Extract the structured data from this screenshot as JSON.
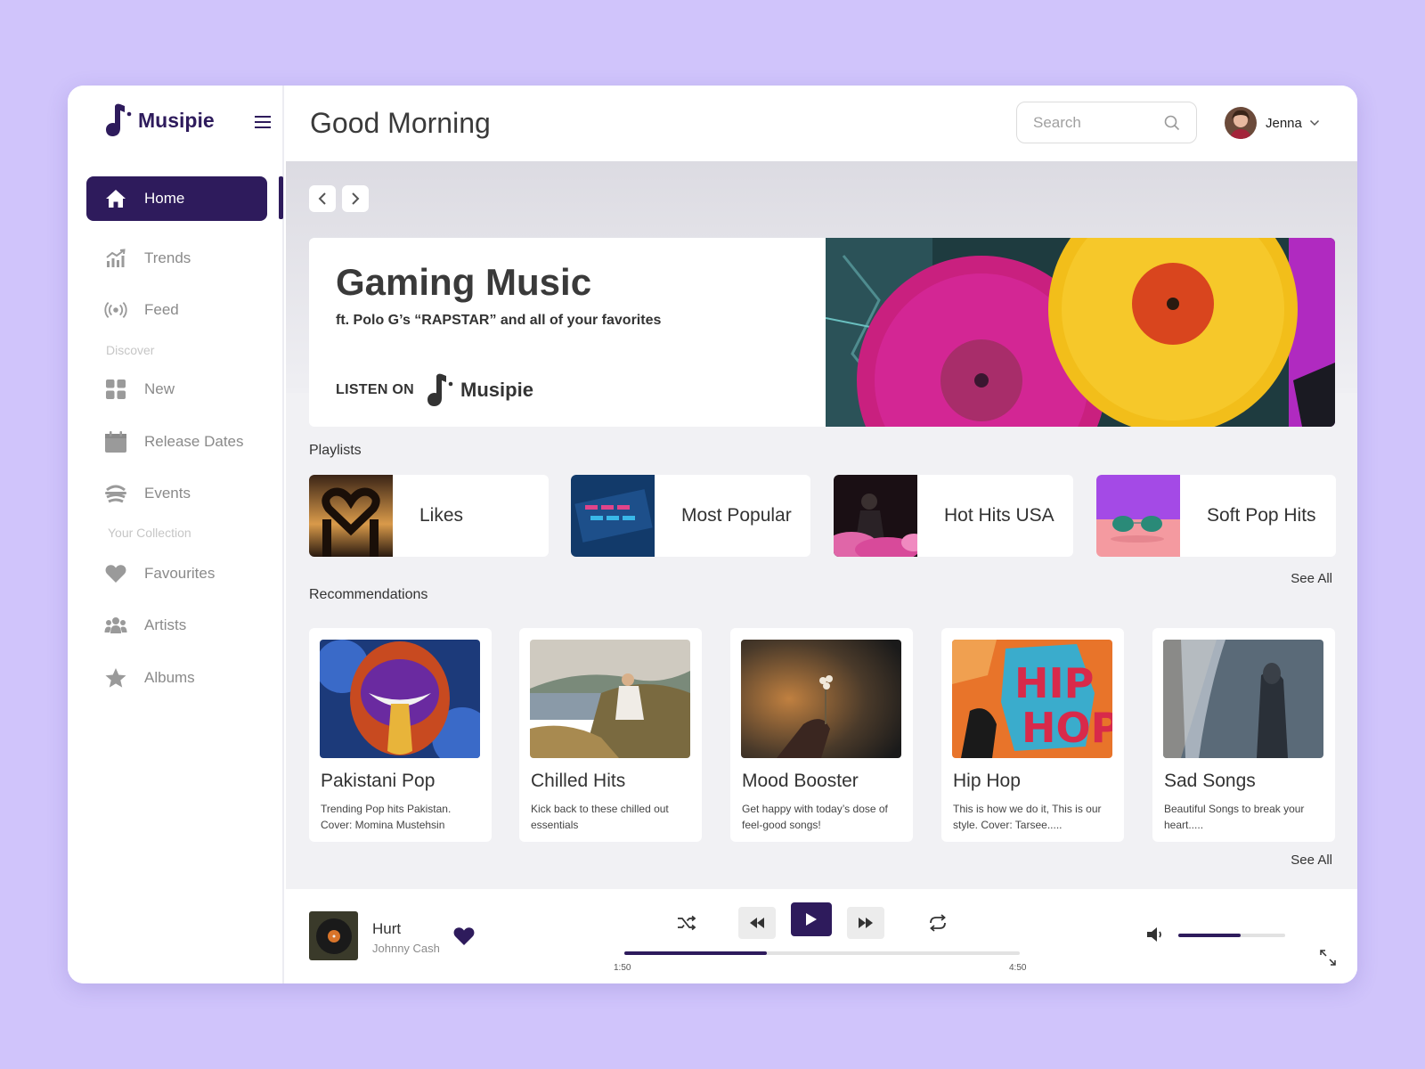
{
  "app": {
    "name": "Musipie",
    "accent_color": "#2e1b5c",
    "background_color": "#d0c4fb"
  },
  "sidebar": {
    "items_top": [
      {
        "label": "Home",
        "icon": "home-icon",
        "active": true
      },
      {
        "label": "Trends",
        "icon": "trends-icon"
      },
      {
        "label": "Feed",
        "icon": "feed-broadcast-icon"
      }
    ],
    "discover_label": "Discover",
    "items_discover": [
      {
        "label": "New",
        "icon": "grid-icon"
      },
      {
        "label": "Release Dates",
        "icon": "calendar-icon"
      },
      {
        "label": "Events",
        "icon": "events-icon"
      }
    ],
    "collection_label": "Your Collection",
    "items_collection": [
      {
        "label": "Favourites",
        "icon": "heart-icon"
      },
      {
        "label": "Artists",
        "icon": "people-icon"
      },
      {
        "label": "Albums",
        "icon": "star-icon"
      }
    ]
  },
  "header": {
    "greeting": "Good Morning",
    "search_placeholder": "Search",
    "user_name": "Jenna"
  },
  "hero": {
    "title": "Gaming Music",
    "subtitle": "ft. Polo G’s “RAPSTAR” and all of your favorites",
    "listen_label": "LISTEN ON",
    "brand": "Musipie"
  },
  "playlists": {
    "title": "Playlists",
    "items": [
      {
        "name": "Likes"
      },
      {
        "name": "Most Popular"
      },
      {
        "name": "Hot Hits USA"
      },
      {
        "name": "Soft Pop Hits"
      }
    ],
    "see_all": "See All"
  },
  "recommendations": {
    "title": "Recommendations",
    "items": [
      {
        "title": "Pakistani Pop",
        "desc": "Trending Pop hits Pakistan. Cover: Momina Mustehsin"
      },
      {
        "title": "Chilled Hits",
        "desc": "Kick back to these chilled out essentials"
      },
      {
        "title": "Mood Booster",
        "desc": "Get happy with today’s dose of feel-good songs!"
      },
      {
        "title": "Hip Hop",
        "desc": "This is how we do it, This is our style. Cover: Tarsee....."
      },
      {
        "title": "Sad Songs",
        "desc": "Beautiful Songs to break your heart....."
      }
    ],
    "see_all": "See All"
  },
  "player": {
    "track": "Hurt",
    "artist": "Johnny Cash",
    "elapsed": "1:50",
    "duration": "4:50",
    "progress": 0.36,
    "volume": 0.58
  }
}
